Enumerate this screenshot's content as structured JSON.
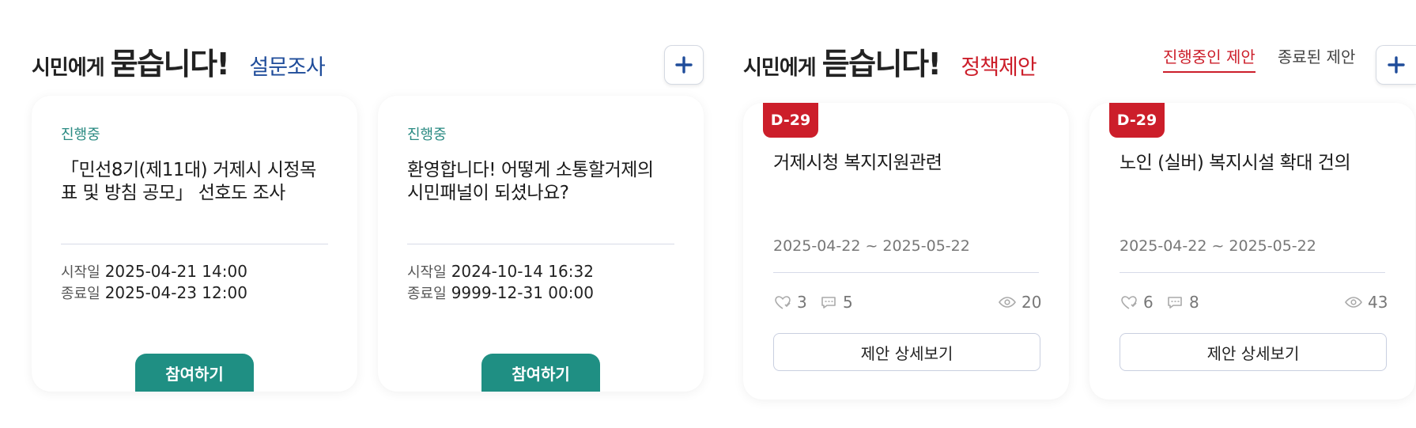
{
  "survey": {
    "heading_small": "시민에게",
    "heading_big": "묻습니다!",
    "heading_sub": "설문조사",
    "sub_color": "#1f4c9a",
    "cards": [
      {
        "status": "진행중",
        "title": "「민선8기(제11대) 거제시 시정목표 및 방침 공모」 선호도 조사",
        "start_label": "시작일",
        "start": "2025-04-21 14:00",
        "end_label": "종료일",
        "end": "2025-04-23 12:00",
        "button": "참여하기"
      },
      {
        "status": "진행중",
        "title": "환영합니다! 어떻게 소통할거제의 시민패널이 되셨나요?",
        "start_label": "시작일",
        "start": "2024-10-14 16:32",
        "end_label": "종료일",
        "end": "9999-12-31 00:00",
        "button": "참여하기"
      }
    ]
  },
  "proposal": {
    "heading_small": "시민에게",
    "heading_big": "듣습니다!",
    "heading_sub": "정책제안",
    "sub_color": "#cc1e2a",
    "tabs": [
      {
        "label": "진행중인 제안",
        "active": true
      },
      {
        "label": "종료된 제안",
        "active": false
      }
    ],
    "cards": [
      {
        "dday": "D-29",
        "title": "거제시청 복지지원관련",
        "period": "2025-04-22 ~ 2025-05-22",
        "likes": "3",
        "comments": "5",
        "views": "20",
        "button": "제안 상세보기"
      },
      {
        "dday": "D-29",
        "title": "노인 (실버) 복지시설 확대 건의",
        "period": "2025-04-22 ~ 2025-05-22",
        "likes": "6",
        "comments": "8",
        "views": "43",
        "button": "제안 상세보기"
      }
    ]
  },
  "icons": {
    "plus": "plus-icon",
    "like": "heart-like-icon",
    "comment": "comment-bubble-icon",
    "view": "eye-icon"
  },
  "colors": {
    "teal": "#1f8f83",
    "red": "#cc1e2a",
    "navy": "#1f4c9a"
  }
}
